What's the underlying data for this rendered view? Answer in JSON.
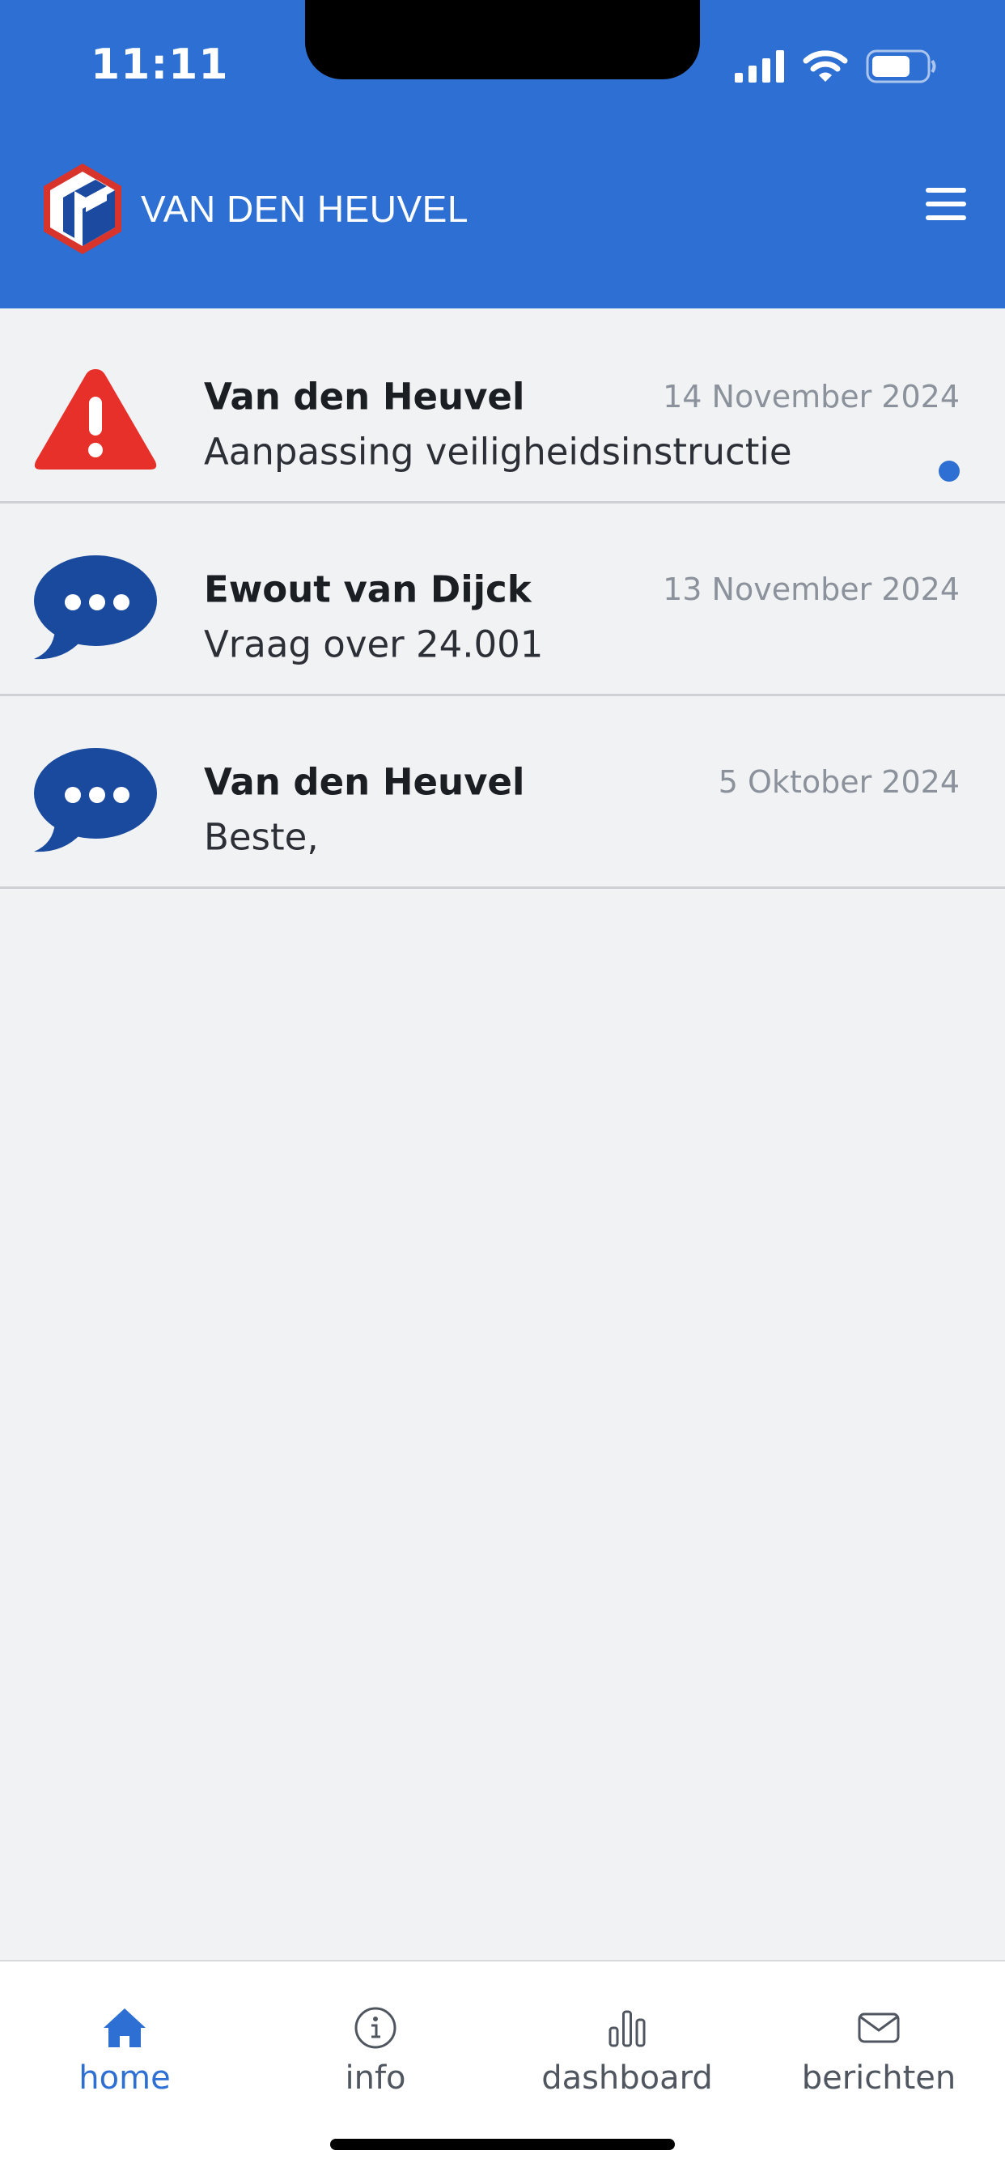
{
  "status_bar": {
    "time": "11:11"
  },
  "header": {
    "brand": "VAN DEN HEUVEL",
    "menu_icon": "hamburger-icon"
  },
  "messages": [
    {
      "icon": "warning-icon",
      "sender": "Van den Heuvel",
      "date": "14 November 2024",
      "subject": "Aanpassing veiligheidsinstructie",
      "unread": true
    },
    {
      "icon": "chat-bubble-icon",
      "sender": "Ewout van Dijck",
      "date": "13 November 2024",
      "subject": "Vraag over 24.001",
      "unread": false
    },
    {
      "icon": "chat-bubble-icon",
      "sender": "Van den Heuvel",
      "date": "5 Oktober 2024",
      "subject": "Beste,",
      "unread": false
    }
  ],
  "tabs": [
    {
      "label": "home",
      "icon": "home-icon",
      "active": true
    },
    {
      "label": "info",
      "icon": "info-icon",
      "active": false
    },
    {
      "label": "dashboard",
      "icon": "bar-chart-icon",
      "active": false
    },
    {
      "label": "berichten",
      "icon": "envelope-icon",
      "active": false
    }
  ],
  "colors": {
    "primary": "#2d6fd2",
    "warning": "#e8302a",
    "chat": "#1a4a9e",
    "background": "#f0f2f4"
  }
}
